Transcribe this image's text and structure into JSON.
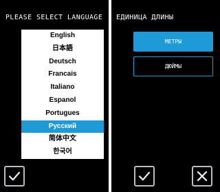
{
  "language_panel": {
    "title": "PLEASE SELECT LANGUAGE",
    "languages": [
      "English",
      "日本語",
      "Deutsch",
      "Francais",
      "Italiano",
      "Espanol",
      "Portugues",
      "Русский",
      "简体中文",
      "한국어"
    ],
    "selected_index": 7,
    "confirm_icon": "checkmark-icon"
  },
  "unit_panel": {
    "title": "ЕДИНИЦА ДЛИНЫ",
    "options": [
      "МЕТРЫ",
      "ДЮЙМЫ"
    ],
    "selected_index": 0,
    "confirm_icon": "checkmark-icon",
    "cancel_icon": "close-icon"
  },
  "colors": {
    "accent": "#1e9bd6",
    "background": "#000000",
    "icon_border": "#b9bec4"
  }
}
